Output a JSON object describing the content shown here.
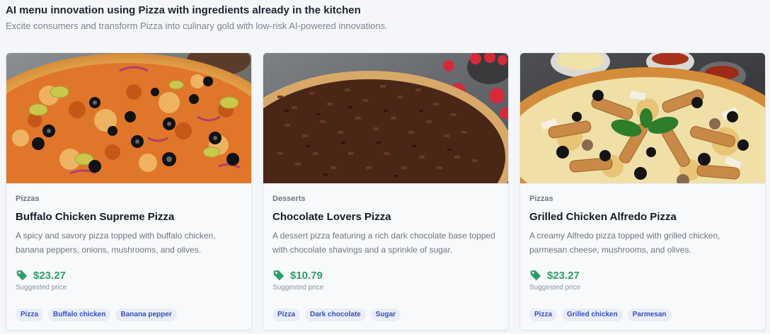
{
  "header": {
    "title": "AI menu innovation using Pizza with ingredients already in the kitchen",
    "subtitle": "Excite consumers and transform Pizza into culinary gold with low-risk AI-powered innovations."
  },
  "colors": {
    "price_green": "#2f9e66",
    "chip_text": "#3650b8",
    "chip_bg": "#e9edf8"
  },
  "cards": [
    {
      "category": "Pizzas",
      "name": "Buffalo Chicken Supreme Pizza",
      "description": "A spicy and savory pizza topped with buffalo chicken, banana peppers, onions, mushrooms, and olives.",
      "price": "$23.27",
      "price_note": "Suggested price",
      "icon": "price-tag-icon",
      "chips": [
        "Pizza",
        "Buffalo chicken",
        "Banana pepper"
      ]
    },
    {
      "category": "Desserts",
      "name": "Chocolate Lovers Pizza",
      "description": "A dessert pizza featuring a rich dark chocolate base topped with chocolate shavings and a sprinkle of sugar.",
      "price": "$10.79",
      "price_note": "Suggested price",
      "icon": "price-tag-icon",
      "chips": [
        "Pizza",
        "Dark chocolate",
        "Sugar"
      ]
    },
    {
      "category": "Pizzas",
      "name": "Grilled Chicken Alfredo Pizza",
      "description": "A creamy Alfredo pizza topped with grilled chicken, parmesan cheese, mushrooms, and olives.",
      "price": "$23.27",
      "price_note": "Suggested price",
      "icon": "price-tag-icon",
      "chips": [
        "Pizza",
        "Grilled chicken",
        "Parmesan"
      ]
    }
  ]
}
